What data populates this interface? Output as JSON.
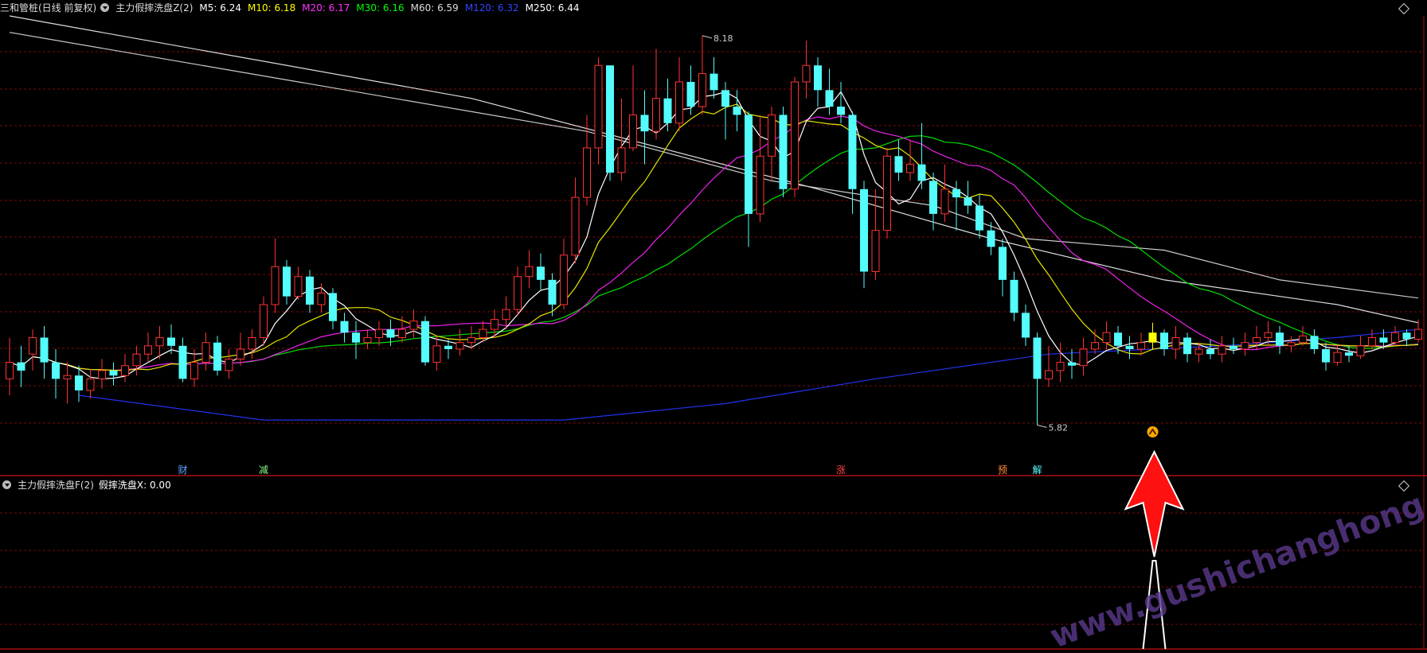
{
  "header": {
    "prefix": "三和管桩(日线 前复权)",
    "indicator": "主力假摔洗盘Z(2)",
    "ma": [
      {
        "label": "M5: 6.24",
        "color": "#ffffff"
      },
      {
        "label": "M10: 6.18",
        "color": "#ffff00"
      },
      {
        "label": "M20: 6.17",
        "color": "#ff33ff"
      },
      {
        "label": "M30: 6.16",
        "color": "#00ff00"
      },
      {
        "label": "M60: 6.59",
        "color": "#dddddd"
      },
      {
        "label": "M120: 6.32",
        "color": "#3344ff"
      },
      {
        "label": "M250: 6.44",
        "color": "#ffffff"
      }
    ]
  },
  "sub_header": {
    "indicator": "主力假摔洗盘F(2)",
    "value_label": "假摔洗盘X: 0.00"
  },
  "annotations": {
    "high_label": "8.18",
    "low_label": "5.82",
    "markers": [
      {
        "text": "财",
        "color": "#5fa8ff",
        "candle": 15
      },
      {
        "text": "减",
        "color": "#88ff88",
        "candle": 22
      },
      {
        "text": "涨",
        "color": "#ff4444",
        "candle": 72
      },
      {
        "text": "预",
        "color": "#ff8833",
        "candle": 86
      },
      {
        "text": "解",
        "color": "#55ffff",
        "candle": 89
      }
    ]
  },
  "watermark": "www.gushichanghong.com",
  "colors": {
    "up": "#ff3333",
    "down": "#54fcfc",
    "highlight": "#ffff00",
    "grid": "#7a0a0a",
    "border": "#aa1111",
    "arrow": "#ff1111"
  },
  "chart_data": {
    "type": "candlestick",
    "price_range": [
      5.6,
      8.3
    ],
    "high": 8.18,
    "low": 5.82,
    "highlight_candle": 99,
    "signal_candle": 99,
    "candles": [
      [
        6.1,
        6.2,
        6.35,
        6.0
      ],
      [
        6.2,
        6.15,
        6.3,
        6.05
      ],
      [
        6.25,
        6.35,
        6.4,
        6.15
      ],
      [
        6.35,
        6.2,
        6.42,
        6.1
      ],
      [
        6.2,
        6.1,
        6.28,
        5.98
      ],
      [
        6.1,
        6.12,
        6.2,
        5.95
      ],
      [
        6.12,
        6.03,
        6.18,
        5.96
      ],
      [
        6.03,
        6.1,
        6.16,
        5.98
      ],
      [
        6.1,
        6.15,
        6.22,
        6.04
      ],
      [
        6.15,
        6.12,
        6.2,
        6.06
      ],
      [
        6.12,
        6.18,
        6.25,
        6.08
      ],
      [
        6.18,
        6.25,
        6.3,
        6.12
      ],
      [
        6.25,
        6.3,
        6.38,
        6.2
      ],
      [
        6.3,
        6.35,
        6.42,
        6.22
      ],
      [
        6.35,
        6.3,
        6.43,
        6.25
      ],
      [
        6.3,
        6.1,
        6.35,
        6.08
      ],
      [
        6.1,
        6.2,
        6.28,
        6.05
      ],
      [
        6.2,
        6.32,
        6.38,
        6.15
      ],
      [
        6.32,
        6.15,
        6.36,
        6.12
      ],
      [
        6.15,
        6.22,
        6.28,
        6.1
      ],
      [
        6.22,
        6.28,
        6.38,
        6.18
      ],
      [
        6.28,
        6.35,
        6.4,
        6.22
      ],
      [
        6.35,
        6.55,
        6.6,
        6.3
      ],
      [
        6.55,
        6.78,
        6.95,
        6.5
      ],
      [
        6.78,
        6.6,
        6.82,
        6.55
      ],
      [
        6.6,
        6.72,
        6.78,
        6.58
      ],
      [
        6.72,
        6.55,
        6.76,
        6.5
      ],
      [
        6.55,
        6.62,
        6.68,
        6.5
      ],
      [
        6.62,
        6.45,
        6.65,
        6.4
      ],
      [
        6.45,
        6.38,
        6.5,
        6.32
      ],
      [
        6.38,
        6.32,
        6.45,
        6.22
      ],
      [
        6.32,
        6.35,
        6.4,
        6.28
      ],
      [
        6.35,
        6.4,
        6.45,
        6.3
      ],
      [
        6.4,
        6.35,
        6.46,
        6.3
      ],
      [
        6.35,
        6.4,
        6.48,
        6.32
      ],
      [
        6.4,
        6.45,
        6.52,
        6.35
      ],
      [
        6.45,
        6.2,
        6.48,
        6.18
      ],
      [
        6.2,
        6.3,
        6.36,
        6.15
      ],
      [
        6.3,
        6.28,
        6.34,
        6.22
      ],
      [
        6.28,
        6.32,
        6.4,
        6.24
      ],
      [
        6.32,
        6.35,
        6.42,
        6.28
      ],
      [
        6.35,
        6.4,
        6.45,
        6.32
      ],
      [
        6.4,
        6.46,
        6.52,
        6.35
      ],
      [
        6.46,
        6.52,
        6.6,
        6.4
      ],
      [
        6.52,
        6.72,
        6.78,
        6.48
      ],
      [
        6.72,
        6.78,
        6.88,
        6.65
      ],
      [
        6.78,
        6.7,
        6.86,
        6.64
      ],
      [
        6.7,
        6.55,
        6.74,
        6.48
      ],
      [
        6.55,
        6.85,
        6.95,
        6.52
      ],
      [
        6.85,
        7.2,
        7.32,
        6.8
      ],
      [
        7.2,
        7.5,
        7.7,
        7.15
      ],
      [
        7.5,
        8.0,
        8.05,
        7.4
      ],
      [
        8.0,
        7.35,
        8.0,
        7.3
      ],
      [
        7.35,
        7.5,
        7.8,
        7.3
      ],
      [
        7.5,
        7.7,
        8.0,
        7.48
      ],
      [
        7.7,
        7.6,
        7.85,
        7.4
      ],
      [
        7.6,
        7.8,
        8.1,
        7.55
      ],
      [
        7.8,
        7.65,
        7.92,
        7.6
      ],
      [
        7.65,
        7.9,
        8.05,
        7.6
      ],
      [
        7.9,
        7.75,
        8.0,
        7.7
      ],
      [
        7.75,
        7.95,
        8.18,
        7.7
      ],
      [
        7.95,
        7.85,
        8.05,
        7.8
      ],
      [
        7.85,
        7.75,
        7.9,
        7.55
      ],
      [
        7.75,
        7.7,
        7.85,
        7.6
      ],
      [
        7.7,
        7.1,
        7.72,
        6.9
      ],
      [
        7.1,
        7.45,
        7.7,
        7.05
      ],
      [
        7.45,
        7.7,
        7.75,
        7.3
      ],
      [
        7.7,
        7.25,
        7.75,
        7.2
      ],
      [
        7.25,
        7.9,
        7.93,
        7.2
      ],
      [
        7.9,
        8.0,
        8.15,
        7.8
      ],
      [
        8.0,
        7.85,
        8.05,
        7.75
      ],
      [
        7.85,
        7.75,
        7.98,
        7.7
      ],
      [
        7.75,
        7.7,
        7.9,
        7.65
      ],
      [
        7.7,
        7.25,
        7.72,
        7.1
      ],
      [
        7.25,
        6.75,
        7.3,
        6.65
      ],
      [
        6.75,
        7.0,
        7.25,
        6.7
      ],
      [
        7.0,
        7.45,
        7.5,
        6.95
      ],
      [
        7.45,
        7.35,
        7.55,
        7.3
      ],
      [
        7.35,
        7.4,
        7.55,
        7.3
      ],
      [
        7.4,
        7.3,
        7.65,
        7.25
      ],
      [
        7.3,
        7.1,
        7.35,
        7.0
      ],
      [
        7.1,
        7.25,
        7.4,
        7.05
      ],
      [
        7.25,
        7.2,
        7.3,
        7.0
      ],
      [
        7.2,
        7.15,
        7.3,
        7.1
      ],
      [
        7.15,
        7.0,
        7.22,
        6.95
      ],
      [
        7.0,
        6.9,
        7.05,
        6.85
      ],
      [
        6.9,
        6.7,
        6.95,
        6.6
      ],
      [
        6.7,
        6.5,
        6.75,
        6.45
      ],
      [
        6.5,
        6.35,
        6.55,
        6.3
      ],
      [
        6.35,
        6.1,
        6.38,
        5.82
      ],
      [
        6.1,
        6.15,
        6.3,
        6.05
      ],
      [
        6.15,
        6.2,
        6.32,
        6.08
      ],
      [
        6.2,
        6.18,
        6.28,
        6.1
      ],
      [
        6.18,
        6.28,
        6.35,
        6.12
      ],
      [
        6.28,
        6.32,
        6.4,
        6.25
      ],
      [
        6.32,
        6.38,
        6.45,
        6.28
      ],
      [
        6.38,
        6.3,
        6.42,
        6.25
      ],
      [
        6.3,
        6.28,
        6.36,
        6.22
      ],
      [
        6.28,
        6.32,
        6.38,
        6.24
      ],
      [
        6.32,
        6.38,
        6.44,
        6.28
      ],
      [
        6.38,
        6.28,
        6.4,
        6.24
      ],
      [
        6.28,
        6.35,
        6.42,
        6.22
      ],
      [
        6.35,
        6.25,
        6.38,
        6.2
      ],
      [
        6.25,
        6.28,
        6.32,
        6.2
      ],
      [
        6.28,
        6.25,
        6.34,
        6.22
      ],
      [
        6.25,
        6.3,
        6.36,
        6.2
      ],
      [
        6.3,
        6.28,
        6.35,
        6.25
      ],
      [
        6.28,
        6.32,
        6.38,
        6.24
      ],
      [
        6.32,
        6.35,
        6.42,
        6.28
      ],
      [
        6.35,
        6.38,
        6.45,
        6.3
      ],
      [
        6.38,
        6.3,
        6.42,
        6.25
      ],
      [
        6.3,
        6.32,
        6.36,
        6.26
      ],
      [
        6.32,
        6.36,
        6.42,
        6.3
      ],
      [
        6.36,
        6.28,
        6.4,
        6.25
      ],
      [
        6.28,
        6.2,
        6.32,
        6.15
      ],
      [
        6.2,
        6.26,
        6.3,
        6.18
      ],
      [
        6.26,
        6.24,
        6.3,
        6.2
      ],
      [
        6.24,
        6.3,
        6.36,
        6.22
      ],
      [
        6.3,
        6.35,
        6.4,
        6.28
      ],
      [
        6.35,
        6.32,
        6.4,
        6.28
      ],
      [
        6.32,
        6.38,
        6.42,
        6.3
      ],
      [
        6.38,
        6.34,
        6.4,
        6.3
      ],
      [
        6.34,
        6.4,
        6.46,
        6.32
      ]
    ],
    "m60": [
      [
        0,
        8.2
      ],
      [
        50,
        7.6
      ],
      [
        66,
        7.3
      ],
      [
        80,
        7.15
      ],
      [
        88,
        6.95
      ],
      [
        100,
        6.88
      ],
      [
        110,
        6.7
      ],
      [
        122,
        6.59
      ]
    ],
    "m250": [
      [
        0,
        8.3
      ],
      [
        40,
        7.8
      ],
      [
        70,
        7.25
      ],
      [
        85,
        6.95
      ],
      [
        100,
        6.7
      ],
      [
        115,
        6.55
      ],
      [
        122,
        6.44
      ]
    ],
    "m120": [
      [
        6,
        6.0
      ],
      [
        22,
        5.85
      ],
      [
        48,
        5.85
      ],
      [
        62,
        5.95
      ],
      [
        75,
        6.1
      ],
      [
        90,
        6.25
      ],
      [
        105,
        6.3
      ],
      [
        115,
        6.35
      ],
      [
        122,
        6.4
      ]
    ]
  }
}
